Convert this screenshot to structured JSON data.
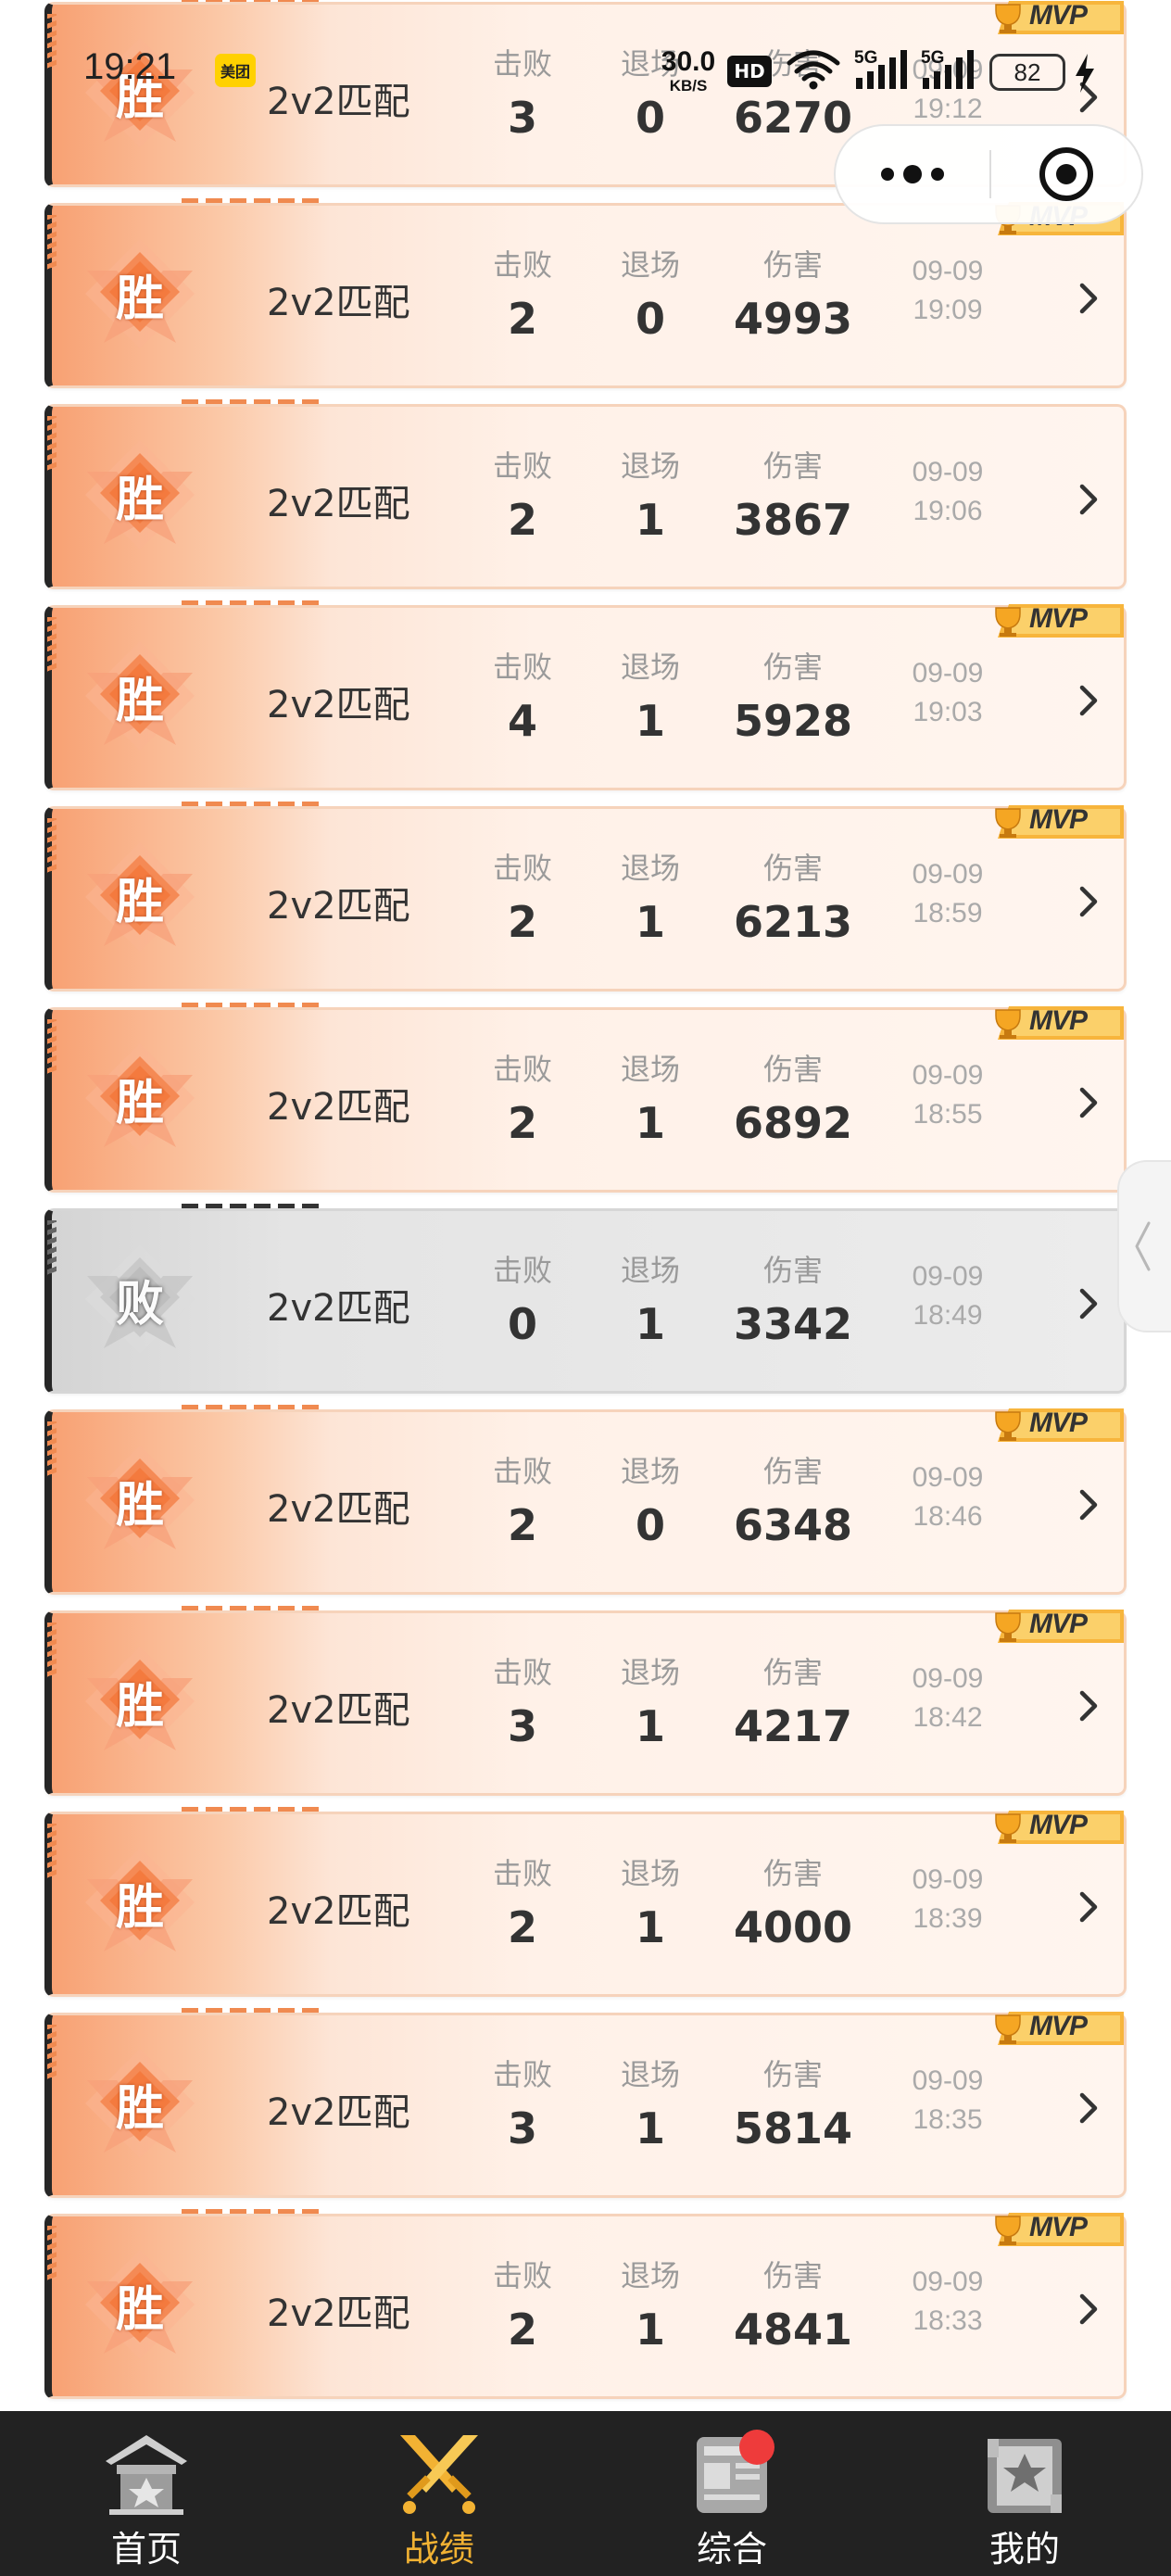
{
  "status_bar": {
    "time": "19:21",
    "app_badge": "美团",
    "net_speed_value": "30.0",
    "net_speed_unit": "KB/S",
    "hd_label": "HD",
    "signal_1_label": "5G",
    "signal_2_label": "5G",
    "battery_level": "82"
  },
  "matches": [
    {
      "result": "胜",
      "outcome": "win",
      "mode": "2v2匹配",
      "kills": "3",
      "exits": "0",
      "damage": "6270",
      "date": "09-09",
      "time": "19:12",
      "mvp": true
    },
    {
      "result": "胜",
      "outcome": "win",
      "mode": "2v2匹配",
      "kills": "2",
      "exits": "0",
      "damage": "4993",
      "date": "09-09",
      "time": "19:09",
      "mvp": true
    },
    {
      "result": "胜",
      "outcome": "win",
      "mode": "2v2匹配",
      "kills": "2",
      "exits": "1",
      "damage": "3867",
      "date": "09-09",
      "time": "19:06",
      "mvp": false
    },
    {
      "result": "胜",
      "outcome": "win",
      "mode": "2v2匹配",
      "kills": "4",
      "exits": "1",
      "damage": "5928",
      "date": "09-09",
      "time": "19:03",
      "mvp": true
    },
    {
      "result": "胜",
      "outcome": "win",
      "mode": "2v2匹配",
      "kills": "2",
      "exits": "1",
      "damage": "6213",
      "date": "09-09",
      "time": "18:59",
      "mvp": true
    },
    {
      "result": "胜",
      "outcome": "win",
      "mode": "2v2匹配",
      "kills": "2",
      "exits": "1",
      "damage": "6892",
      "date": "09-09",
      "time": "18:55",
      "mvp": true
    },
    {
      "result": "败",
      "outcome": "loss",
      "mode": "2v2匹配",
      "kills": "0",
      "exits": "1",
      "damage": "3342",
      "date": "09-09",
      "time": "18:49",
      "mvp": false
    },
    {
      "result": "胜",
      "outcome": "win",
      "mode": "2v2匹配",
      "kills": "2",
      "exits": "0",
      "damage": "6348",
      "date": "09-09",
      "time": "18:46",
      "mvp": true
    },
    {
      "result": "胜",
      "outcome": "win",
      "mode": "2v2匹配",
      "kills": "3",
      "exits": "1",
      "damage": "4217",
      "date": "09-09",
      "time": "18:42",
      "mvp": true
    },
    {
      "result": "胜",
      "outcome": "win",
      "mode": "2v2匹配",
      "kills": "2",
      "exits": "1",
      "damage": "4000",
      "date": "09-09",
      "time": "18:39",
      "mvp": true
    },
    {
      "result": "胜",
      "outcome": "win",
      "mode": "2v2匹配",
      "kills": "3",
      "exits": "1",
      "damage": "5814",
      "date": "09-09",
      "time": "18:35",
      "mvp": true
    },
    {
      "result": "胜",
      "outcome": "win",
      "mode": "2v2匹配",
      "kills": "2",
      "exits": "1",
      "damage": "4841",
      "date": "09-09",
      "time": "18:33",
      "mvp": true
    }
  ],
  "labels": {
    "kills": "击败",
    "exits": "退场",
    "damage": "伤害",
    "mvp": "MVP"
  },
  "nav": {
    "items": [
      {
        "label": "首页",
        "icon": "home-temple-icon",
        "active": false,
        "badge": false
      },
      {
        "label": "战绩",
        "icon": "crossed-swords-icon",
        "active": true,
        "badge": false
      },
      {
        "label": "综合",
        "icon": "newspaper-icon",
        "active": false,
        "badge": true
      },
      {
        "label": "我的",
        "icon": "profile-card-icon",
        "active": false,
        "badge": false
      }
    ]
  },
  "colors": {
    "win_accent": "#f08a50",
    "loss_accent": "#cfcfcf",
    "active_nav": "#f2b233",
    "nav_bg": "#222222",
    "notification": "#ee3b3b"
  }
}
